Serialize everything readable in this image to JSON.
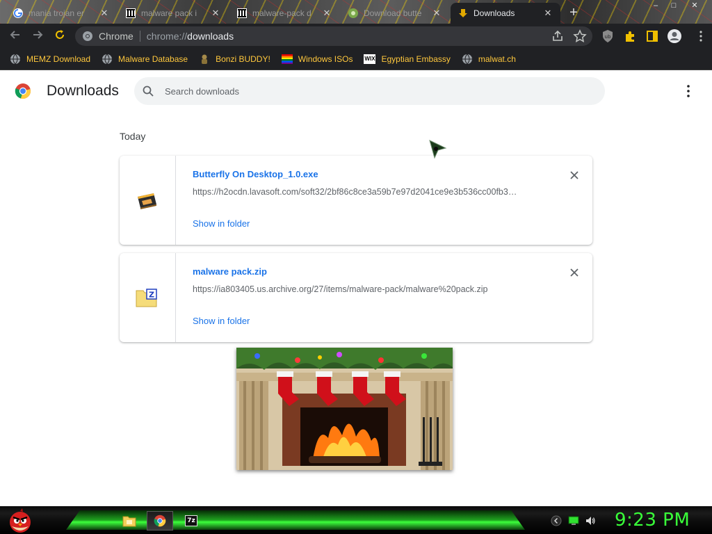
{
  "tabs": [
    {
      "title": "mania trojan er",
      "active": false
    },
    {
      "title": "malware pack i",
      "active": false
    },
    {
      "title": "malware-pack d",
      "active": false
    },
    {
      "title": "Download butte",
      "active": false
    },
    {
      "title": "Downloads",
      "active": true
    }
  ],
  "tab_close_glyph": "✕",
  "new_tab_glyph": "+",
  "window_controls": {
    "minimize": "–",
    "maximize": "□",
    "close": "✕"
  },
  "omnibox": {
    "scheme": "Chrome",
    "url_prefix": "chrome://",
    "url_host": "downloads"
  },
  "bookmarks": [
    {
      "label": "MEMZ Download",
      "icon": "globe-icon"
    },
    {
      "label": "Malware Database",
      "icon": "globe-icon"
    },
    {
      "label": "Bonzi BUDDY!",
      "icon": "bonzi-icon"
    },
    {
      "label": "Windows ISOs",
      "icon": "rainbow-flag-icon"
    },
    {
      "label": "Egyptian Embassy",
      "icon": "wix-icon"
    },
    {
      "label": "malwat.ch",
      "icon": "globe-icon"
    }
  ],
  "wix_text": "WIX",
  "page": {
    "title": "Downloads",
    "search_placeholder": "Search downloads",
    "section_label": "Today"
  },
  "downloads": [
    {
      "file_name": "Butterfly On Desktop_1.0.exe",
      "url": "https://h2ocdn.lavasoft.com/soft32/2bf86c8ce3a59b7e97d2041ce9e3b536cc00fb3…",
      "action": "Show in folder",
      "icon": "exe-installer-icon"
    },
    {
      "file_name": "malware pack.zip",
      "url": "https://ia803405.us.archive.org/27/items/malware-pack/malware%20pack.zip",
      "action": "Show in folder",
      "icon": "zip-folder-icon"
    }
  ],
  "zip_letter": "Z",
  "taskbar": {
    "clock": "9:23 PM",
    "app_7z_label": "7z"
  },
  "colors": {
    "accent_link": "#1a73e8",
    "bookmark_text": "#ffc83d",
    "clock": "#39ff39",
    "chrome_dark": "#202124"
  }
}
